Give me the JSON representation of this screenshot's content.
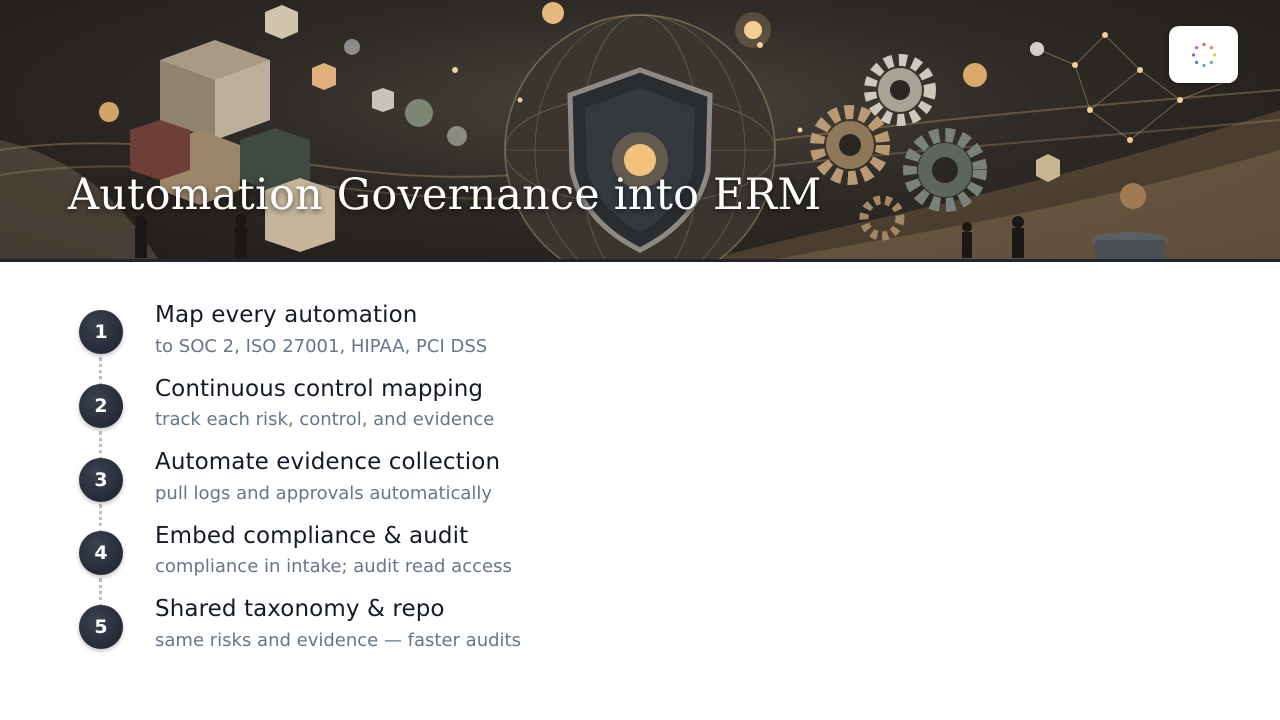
{
  "slide": {
    "title": "Automation Governance into ERM",
    "logo_icon": "ring-of-dots-logo-icon"
  },
  "steps": [
    {
      "number": "1",
      "heading": "Map every automation",
      "sub": "to SOC 2, ISO 27001, HIPAA, PCI DSS"
    },
    {
      "number": "2",
      "heading": "Continuous control mapping",
      "sub": "track each risk, control, and evidence"
    },
    {
      "number": "3",
      "heading": "Automate evidence collection",
      "sub": "pull logs and approvals automatically"
    },
    {
      "number": "4",
      "heading": "Embed compliance & audit",
      "sub": "compliance in intake; audit read access"
    },
    {
      "number": "5",
      "heading": "Shared taxonomy & repo",
      "sub": "same risks and evidence — faster audits"
    }
  ],
  "colors": {
    "circle": "#1c212b",
    "heading": "#141a26",
    "sub": "#66758a",
    "banner_accent": "#c9a46a"
  }
}
